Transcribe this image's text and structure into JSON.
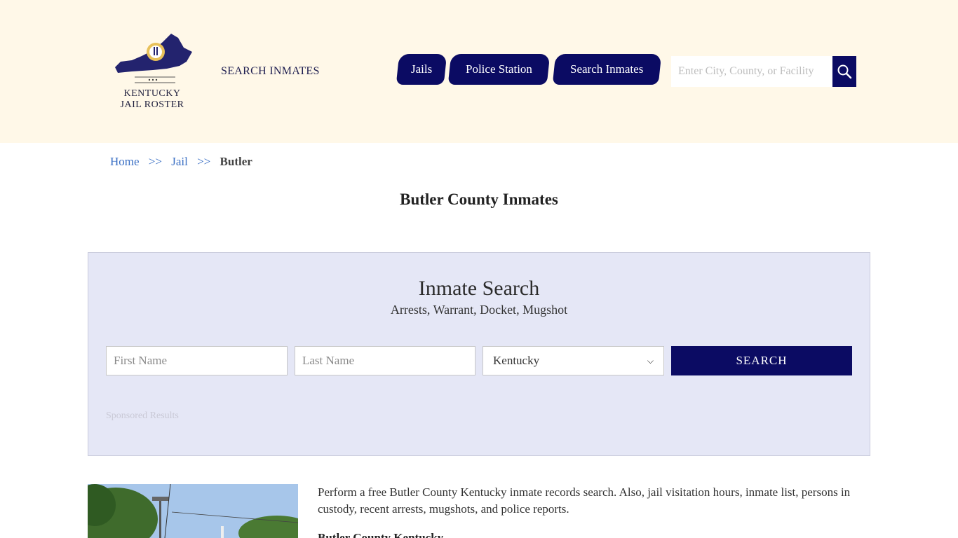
{
  "header": {
    "logo_line1": "KENTUCKY",
    "logo_line2": "JAIL ROSTER",
    "search_inmates_link": "SEARCH INMATES",
    "nav": [
      {
        "label": "Jails"
      },
      {
        "label": "Police Station"
      },
      {
        "label": "Search Inmates"
      }
    ],
    "search": {
      "placeholder": "Enter City, County, or Facility"
    }
  },
  "breadcrumb": {
    "home": "Home",
    "sep": ">>",
    "jail": "Jail",
    "current": "Butler"
  },
  "page_title": "Butler County Inmates",
  "inmate_search": {
    "title": "Inmate Search",
    "subtitle": "Arrests, Warrant, Docket, Mugshot",
    "first_name_placeholder": "First Name",
    "last_name_placeholder": "Last Name",
    "state_selected": "Kentucky",
    "search_button": "SEARCH",
    "sponsored": "Sponsored Results"
  },
  "content": {
    "intro": "Perform a free Butler County Kentucky inmate records search. Also, jail visitation hours, inmate list, persons in custody, recent arrests, mugshots, and police reports.",
    "subheading": "Butler County Kentucky"
  },
  "colors": {
    "header_bg": "#fff8e8",
    "brand_navy": "#0b0b63",
    "panel_bg": "#e5e7f6",
    "link": "#3a6fc4"
  }
}
